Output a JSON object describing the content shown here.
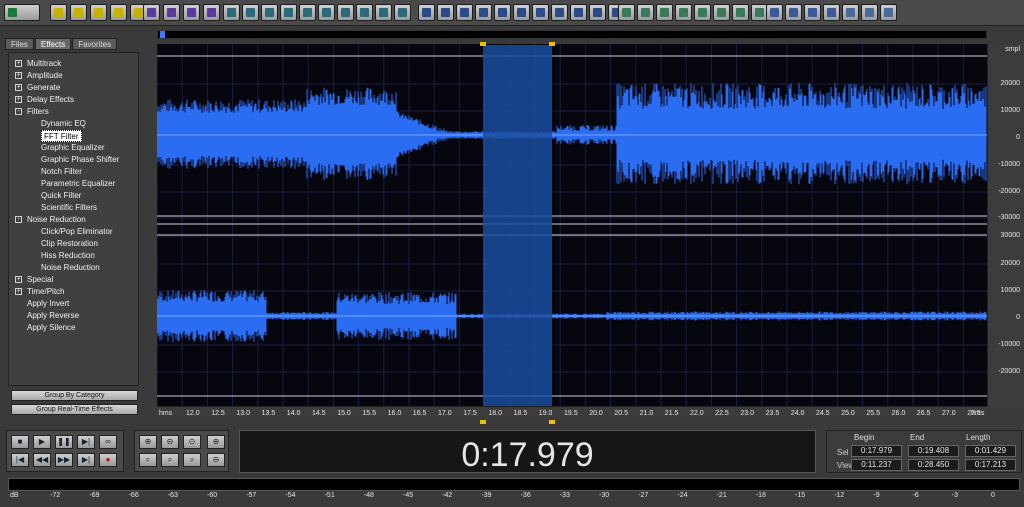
{
  "tabs": [
    {
      "label": "Files"
    },
    {
      "label": "Effects"
    },
    {
      "label": "Favorites"
    }
  ],
  "tree": [
    {
      "label": "Multitrack",
      "level": 0,
      "expander": "+"
    },
    {
      "label": "Amplitude",
      "level": 0,
      "expander": "+"
    },
    {
      "label": "Generate",
      "level": 0,
      "expander": "+"
    },
    {
      "label": "Delay Effects",
      "level": 0,
      "expander": "+"
    },
    {
      "label": "Filters",
      "level": 0,
      "expander": "-"
    },
    {
      "label": "Dynamic EQ",
      "level": 1
    },
    {
      "label": "FFT Filter",
      "level": 1,
      "selected": true
    },
    {
      "label": "Graphic Equalizer",
      "level": 1
    },
    {
      "label": "Graphic Phase Shifter",
      "level": 1
    },
    {
      "label": "Notch Filter",
      "level": 1
    },
    {
      "label": "Parametric Equalizer",
      "level": 1
    },
    {
      "label": "Quick Filter",
      "level": 1
    },
    {
      "label": "Scientific Filters",
      "level": 1
    },
    {
      "label": "Noise Reduction",
      "level": 0,
      "expander": "-"
    },
    {
      "label": "Click/Pop Eliminator",
      "level": 1
    },
    {
      "label": "Clip Restoration",
      "level": 1
    },
    {
      "label": "Hiss Reduction",
      "level": 1
    },
    {
      "label": "Noise Reduction",
      "level": 1
    },
    {
      "label": "Special",
      "level": 0,
      "expander": "+"
    },
    {
      "label": "Time/Pitch",
      "level": 0,
      "expander": "+"
    },
    {
      "label": "Apply Invert",
      "level": 0
    },
    {
      "label": "Apply Reverse",
      "level": 0
    },
    {
      "label": "Apply Silence",
      "level": 0
    }
  ],
  "buttons": {
    "group_by_category": "Group By Category",
    "group_realtime": "Group Real-Time Effects"
  },
  "amp_ruler": {
    "unit": "smpl",
    "top": [
      "20000",
      "10000",
      "0",
      "-10000",
      "-20000",
      "-30000"
    ],
    "bottom": [
      "30000",
      "20000",
      "10000",
      "0",
      "-10000",
      "-20000"
    ]
  },
  "time_ruler": {
    "unit": "hms",
    "ticks": [
      "12.0",
      "12.5",
      "13.0",
      "13.5",
      "14.0",
      "14.5",
      "15.0",
      "15.5",
      "16.0",
      "16.5",
      "17.0",
      "17.5",
      "18.0",
      "18.5",
      "19.0",
      "19.5",
      "20.0",
      "20.5",
      "21.0",
      "21.5",
      "22.0",
      "22.5",
      "23.0",
      "23.5",
      "24.0",
      "24.5",
      "25.0",
      "25.5",
      "26.0",
      "26.5",
      "27.0",
      "27.5"
    ]
  },
  "time_display": "0:17.979",
  "selection": {
    "headers": [
      "Begin",
      "End",
      "Length"
    ],
    "rows": [
      {
        "label": "Sel",
        "begin": "0:17.979",
        "end": "0:19.408",
        "length": "0:01.429"
      },
      {
        "label": "View",
        "begin": "0:11.237",
        "end": "0:28.450",
        "length": "0:17.213"
      }
    ]
  },
  "meter": {
    "labels": [
      "dB",
      "-72",
      "-69",
      "-66",
      "-63",
      "-60",
      "-57",
      "-54",
      "-51",
      "-48",
      "-45",
      "-42",
      "-39",
      "-36",
      "-33",
      "-30",
      "-27",
      "-24",
      "-21",
      "-18",
      "-15",
      "-12",
      "-9",
      "-6",
      "-3",
      "0"
    ]
  },
  "colors": {
    "wave": "#2a6cf2",
    "selection": "#1a4ea0",
    "background": "#06060e"
  }
}
